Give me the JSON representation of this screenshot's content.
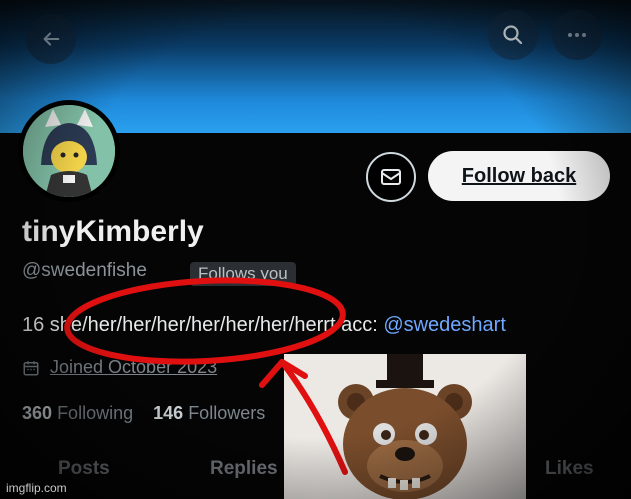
{
  "profile": {
    "name": "tinyKimberly",
    "handle": "@swedenfishe",
    "follows_you": "Follows you",
    "bio_text": "16 she/her/her/her/her/her/her/her",
    "bio_suffix": "rt acc:",
    "bio_link": "@swedeshart",
    "joined": "Joined October 2023",
    "following_count": "360",
    "following_label": "Following",
    "followers_count": "146",
    "followers_label": "Followers"
  },
  "actions": {
    "follow_back": "Follow back"
  },
  "tabs": [
    {
      "label": "Posts"
    },
    {
      "label": "Replies"
    },
    {
      "label": "Likes"
    }
  ],
  "watermark": "imgflip.com",
  "colors": {
    "banner": "#2aa0ef",
    "link": "#6ea8ff",
    "annotation": "#e01010"
  },
  "icons": [
    "back-arrow-icon",
    "search-icon",
    "more-icon",
    "envelope-icon",
    "calendar-icon"
  ]
}
